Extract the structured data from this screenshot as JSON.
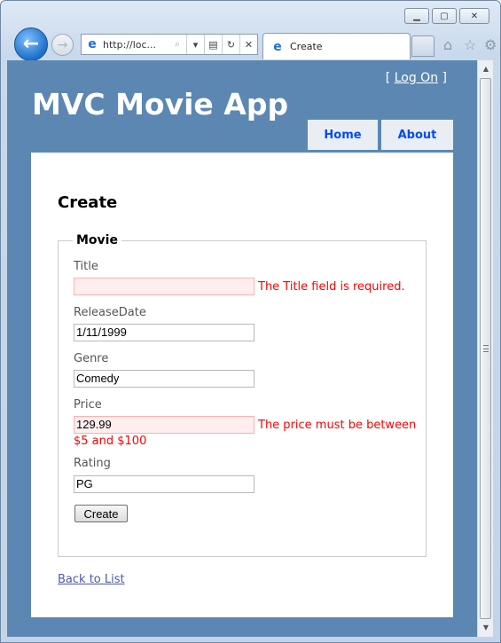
{
  "browser": {
    "address_url": "http://loc...",
    "tab_title": "Create"
  },
  "site": {
    "title": "MVC Movie App",
    "logon": {
      "prefix": "[ ",
      "link": "Log On",
      "suffix": " ]"
    },
    "menu": [
      {
        "label": "Home"
      },
      {
        "label": "About"
      }
    ]
  },
  "page": {
    "heading": "Create",
    "legend": "Movie",
    "fields": {
      "title": {
        "label": "Title",
        "value": "",
        "error": "The Title field is required."
      },
      "release_date": {
        "label": "ReleaseDate",
        "value": "1/11/1999"
      },
      "genre": {
        "label": "Genre",
        "value": "Comedy"
      },
      "price": {
        "label": "Price",
        "value": "129.99",
        "error": "The price must be between $5 and $100"
      },
      "rating": {
        "label": "Rating",
        "value": "PG"
      }
    },
    "submit_label": "Create",
    "back_link": "Back to List"
  },
  "colors": {
    "site_background": "#5c87b2",
    "menu_link": "#034af3",
    "error_text": "#ff0000",
    "error_field_background": "#ffeeee"
  }
}
